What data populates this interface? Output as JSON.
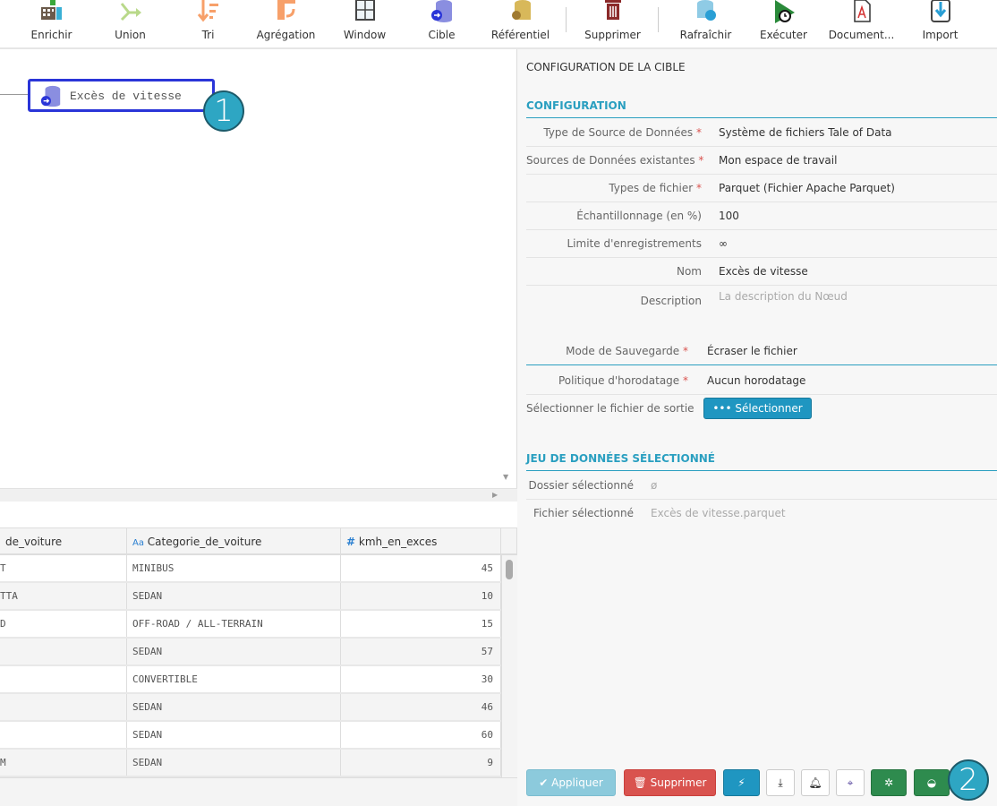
{
  "toolbar": {
    "items": [
      {
        "label": "Enrichir",
        "icon": "enrich-table-icon"
      },
      {
        "label": "Union",
        "icon": "union-icon"
      },
      {
        "label": "Tri",
        "icon": "sort-icon"
      },
      {
        "label": "Agrégation",
        "icon": "aggregation-icon"
      },
      {
        "label": "Window",
        "icon": "window-icon"
      },
      {
        "label": "Cible",
        "icon": "target-database-icon"
      },
      {
        "label": "Référentiel",
        "icon": "referential-icon"
      },
      {
        "label": "Supprimer",
        "icon": "trash-icon"
      },
      {
        "label": "Rafraîchir",
        "icon": "refresh-database-icon"
      },
      {
        "label": "Exécuter",
        "icon": "execute-icon"
      },
      {
        "label": "Document...",
        "icon": "pdf-document-icon"
      },
      {
        "label": "Import",
        "icon": "import-icon"
      }
    ]
  },
  "canvas": {
    "node_label": "Excès de vitesse",
    "badge1": "1"
  },
  "table": {
    "headers": [
      "de_voiture",
      "Categorie_de_voiture",
      "kmh_en_exces"
    ],
    "header_type_icons": [
      "",
      "Aa",
      "#"
    ],
    "rows": [
      [
        "T",
        "MINIBUS",
        "45"
      ],
      [
        "TTA",
        "SEDAN",
        "10"
      ],
      [
        "D",
        "OFF-ROAD / ALL-TERRAIN",
        "15"
      ],
      [
        "",
        "SEDAN",
        "57"
      ],
      [
        "",
        "CONVERTIBLE",
        "30"
      ],
      [
        "",
        "SEDAN",
        "46"
      ],
      [
        "",
        "SEDAN",
        "60"
      ],
      [
        "M",
        "SEDAN",
        "9"
      ]
    ]
  },
  "panel": {
    "title": "CONFIGURATION DE LA CIBLE",
    "config_section": "CONFIGURATION",
    "fields": [
      {
        "label": "Type de Source de Données",
        "required": "*",
        "value": "Système de fichiers Tale of Data"
      },
      {
        "label": "Sources de Données existantes",
        "required": "*",
        "value": "Mon espace de travail"
      },
      {
        "label": "Types de fichier",
        "required": "*",
        "value": "Parquet (Fichier Apache Parquet)"
      },
      {
        "label": "Échantillonnage (en %)",
        "required": "",
        "value": "100"
      },
      {
        "label": "Limite d'enregistrements",
        "required": "",
        "value": "∞"
      },
      {
        "label": "Nom",
        "required": "",
        "value": "Excès de vitesse"
      },
      {
        "label": "Description",
        "required": "",
        "placeholder": "La description du Nœud"
      }
    ],
    "save_mode": {
      "label": "Mode de Sauvegarde",
      "required": "*",
      "value": "Écraser le fichier"
    },
    "timestamp_policy": {
      "label": "Politique d'horodatage",
      "required": "*",
      "value": "Aucun horodatage"
    },
    "output_file": {
      "label": "Sélectionner le fichier de sortie",
      "button": "Sélectionner"
    },
    "dataset_section": "JEU DE DONNÉES SÉLECTIONNÉ",
    "folder": {
      "label": "Dossier sélectionné",
      "value": "ø"
    },
    "file": {
      "label": "Fichier sélectionné",
      "value": "Excès de vitesse.parquet"
    },
    "buttons": {
      "apply": "Appliquer",
      "delete": "Supprimer"
    },
    "badge2": "2"
  },
  "colors": {
    "accent": "#2a9fc0",
    "node_border": "#2a35d8",
    "danger": "#d9534f",
    "success": "#2e8b4e",
    "primary": "#1f96c1"
  }
}
